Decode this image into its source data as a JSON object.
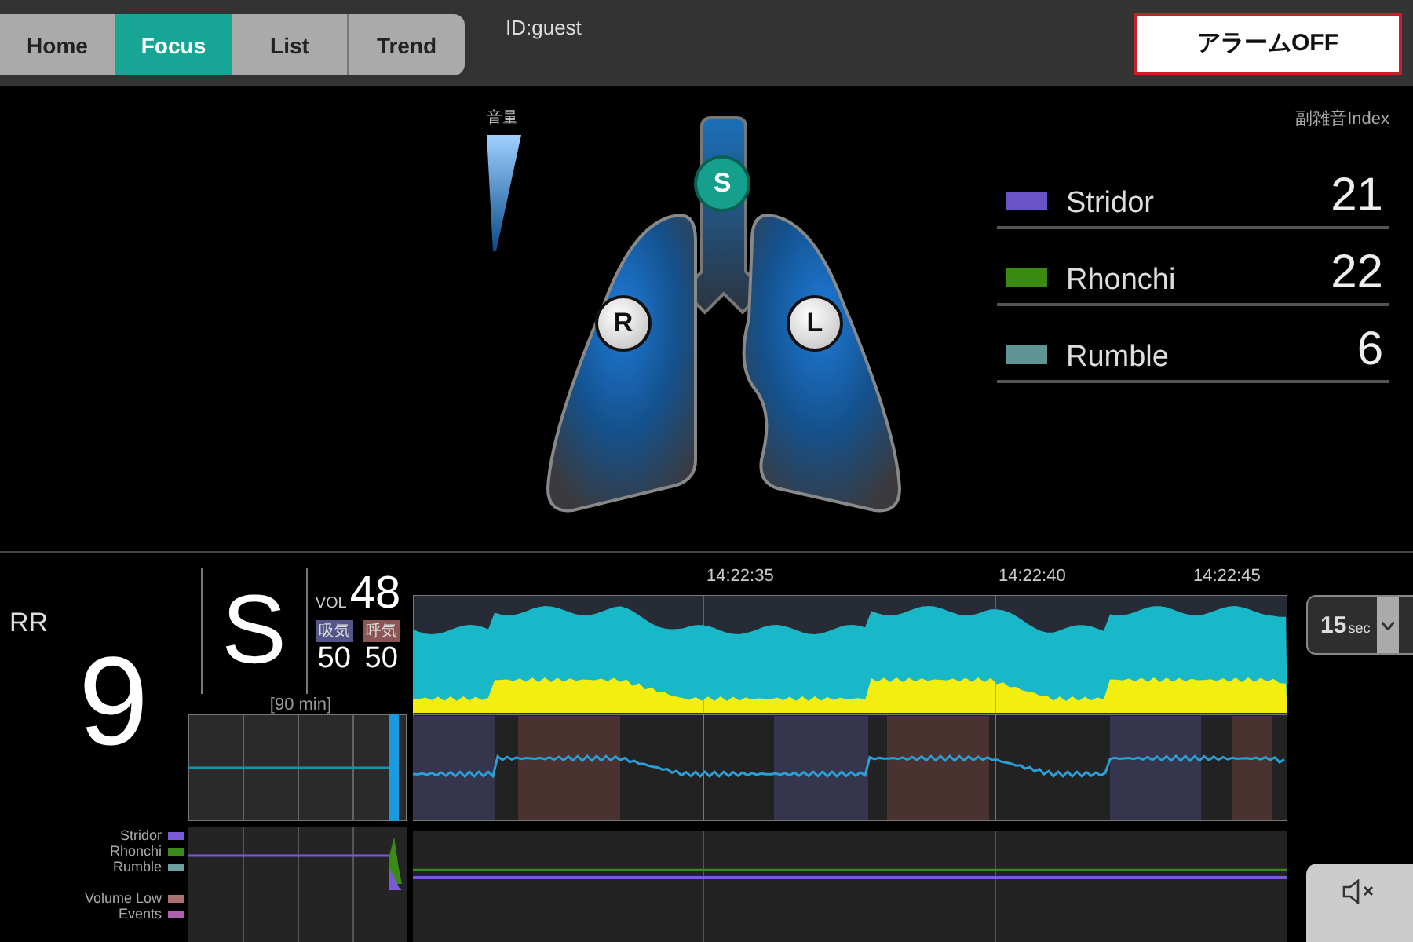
{
  "tabs": [
    {
      "label": "Home",
      "selected": false
    },
    {
      "label": "Focus",
      "selected": true
    },
    {
      "label": "List",
      "selected": false
    },
    {
      "label": "Trend",
      "selected": false
    }
  ],
  "user_id": "ID:guest",
  "alarm_button": "アラームOFF",
  "volume_scale": {
    "label": "音量"
  },
  "lung_markers": [
    {
      "label": "S",
      "selected": true
    },
    {
      "label": "R",
      "selected": false
    },
    {
      "label": "L",
      "selected": false
    }
  ],
  "index_panel": {
    "title": "副雑音Index",
    "rows": [
      {
        "name": "Stridor",
        "color": "#6a52c8",
        "value": "21"
      },
      {
        "name": "Rhonchi",
        "color": "#3a8a12",
        "value": "22"
      },
      {
        "name": "Rumble",
        "color": "#5e9494",
        "value": "6"
      }
    ]
  },
  "respiration": {
    "label": "RR",
    "value": "9"
  },
  "sound_source": "S",
  "volume": {
    "label": "VOL",
    "value": "48"
  },
  "phases": [
    {
      "label": "吸気",
      "value": "50",
      "color": "#55558a"
    },
    {
      "label": "呼気",
      "value": "50",
      "color": "#8a5656"
    }
  ],
  "trend_range": "[90 min]",
  "legend": [
    {
      "label": "Stridor",
      "color": "#7a5ad8"
    },
    {
      "label": "Rhonchi",
      "color": "#3a8a1a"
    },
    {
      "label": "Rumble",
      "color": "#6aa0a0"
    },
    {
      "label": "Volume Low",
      "color": "#b07070"
    },
    {
      "label": "Events",
      "color": "#b060b0"
    }
  ],
  "time_axis": [
    "14:22:35",
    "14:22:40",
    "14:22:45"
  ],
  "window_select": {
    "value": "15",
    "unit": "sec"
  }
}
